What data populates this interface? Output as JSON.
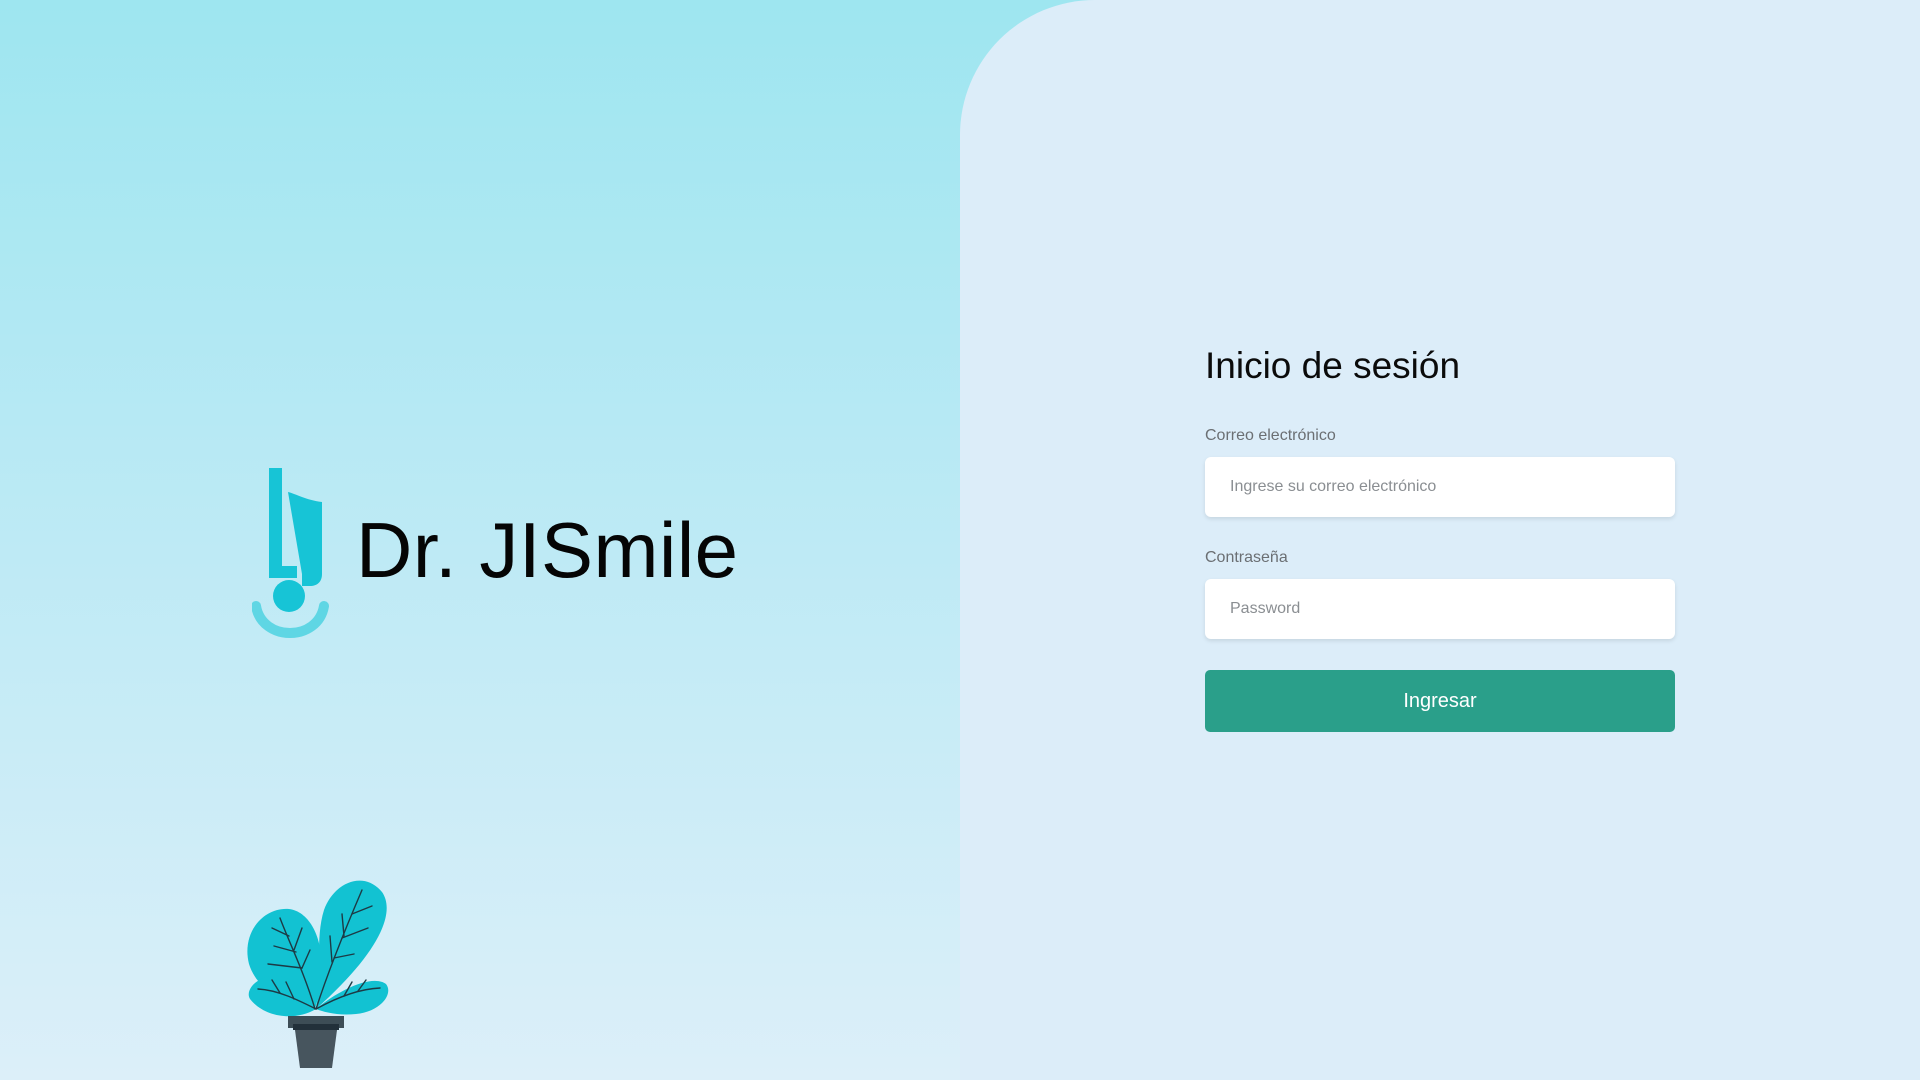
{
  "brand": {
    "name": "Dr. JISmile",
    "logo_icon": "tooth-smile-logo-icon",
    "accent_color": "#17c4d6"
  },
  "decoration": {
    "plant_icon": "potted-plant-icon"
  },
  "login": {
    "title": "Inicio de sesión",
    "email": {
      "label": "Correo electrónico",
      "placeholder": "Ingrese su correo electrónico",
      "value": ""
    },
    "password": {
      "label": "Contraseña",
      "placeholder": "Password",
      "value": ""
    },
    "submit_label": "Ingresar",
    "submit_color": "#2a9f8a"
  }
}
